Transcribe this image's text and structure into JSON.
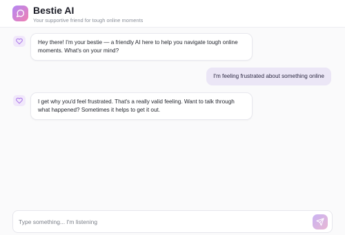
{
  "header": {
    "title": "Bestie AI",
    "subtitle": "Your supportive friend for tough online moments",
    "logo_icon": "chat-bubble-icon"
  },
  "messages": [
    {
      "role": "assistant",
      "avatar_icon": "heart-icon",
      "lines": [
        "Hey there! I'm your bestie — a friendly AI here to help you navigate tough online",
        "moments. What's on your mind?"
      ]
    },
    {
      "role": "user",
      "lines": [
        "I'm feeling frustrated about something online"
      ]
    },
    {
      "role": "assistant",
      "avatar_icon": "heart-icon",
      "lines": [
        "I get why you'd feel frustrated. That's a really valid feeling. Want to talk through",
        "what happened? Sometimes it helps to get it out."
      ]
    }
  ],
  "composer": {
    "placeholder": "Type something... I'm listening",
    "value": "",
    "send_icon": "send-icon"
  },
  "colors": {
    "accent_start": "#b388f5",
    "accent_end": "#f07fb0",
    "user_bubble": "#ebe6f6",
    "avatar_bg": "#f1e8fb"
  }
}
